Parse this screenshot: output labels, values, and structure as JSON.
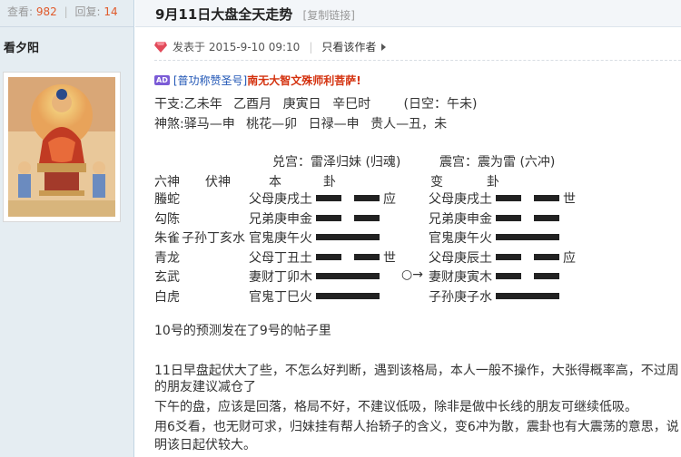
{
  "stats": {
    "views_label": "查看:",
    "views": "982",
    "replies_label": "回复:",
    "replies": "14"
  },
  "user": {
    "name": "看夕阳"
  },
  "thread": {
    "title": "9月11日大盘全天走势",
    "copy_link": "[复制链接]"
  },
  "post": {
    "posted_at": "发表于 2015-9-10 09:10",
    "only_author": "只看该作者"
  },
  "ad": {
    "badge": "AD",
    "link": "[普功称赞圣号]",
    "name": "南无大智文殊师利菩萨!"
  },
  "ganzhi": {
    "label": "干支:",
    "year": "乙未年",
    "month": "乙酉月",
    "day": "庚寅日",
    "hour": "辛巳时",
    "kong": "(日空：午未)"
  },
  "shensha": {
    "label": "神煞:",
    "items": [
      "驿马—申",
      "桃花—卯",
      "日禄—申",
      "贵人—丑，未"
    ]
  },
  "gua": {
    "ben_palace": "兑宫：雷泽归妹 (归魂)",
    "bian_palace": "震宫：震为雷 (六冲)",
    "headers": {
      "liushen": "六神",
      "fushen": "伏神",
      "ben": "本",
      "gua1": "卦",
      "bian": "变",
      "gua2": "卦"
    },
    "rows": [
      {
        "liushen": "螣蛇",
        "fushen": "",
        "ben": "父母庚戌土",
        "ben_yang": false,
        "mark": "应",
        "change": "",
        "bian": "父母庚戌土",
        "bian_yang": false,
        "bian_mark": "世"
      },
      {
        "liushen": "勾陈",
        "fushen": "",
        "ben": "兄弟庚申金",
        "ben_yang": false,
        "mark": "",
        "change": "",
        "bian": "兄弟庚申金",
        "bian_yang": false,
        "bian_mark": ""
      },
      {
        "liushen": "朱雀",
        "fushen": "子孙丁亥水",
        "ben": "官鬼庚午火",
        "ben_yang": true,
        "mark": "",
        "change": "",
        "bian": "官鬼庚午火",
        "bian_yang": true,
        "bian_mark": ""
      },
      {
        "liushen": "青龙",
        "fushen": "",
        "ben": "父母丁丑土",
        "ben_yang": false,
        "mark": "世",
        "change": "",
        "bian": "父母庚辰土",
        "bian_yang": false,
        "bian_mark": "应"
      },
      {
        "liushen": "玄武",
        "fushen": "",
        "ben": "妻财丁卯木",
        "ben_yang": true,
        "mark": "",
        "change": "○→",
        "bian": "妻财庚寅木",
        "bian_yang": false,
        "bian_mark": ""
      },
      {
        "liushen": "白虎",
        "fushen": "",
        "ben": "官鬼丁巳火",
        "ben_yang": true,
        "mark": "",
        "change": "",
        "bian": "子孙庚子水",
        "bian_yang": true,
        "bian_mark": ""
      }
    ]
  },
  "body": {
    "p1": "10号的预测发在了9号的帖子里",
    "p2a": "11日早盘起伏大了些，不怎么好判断，遇到该格局，本人一般不操作，大张得概率高，不过周",
    "p2b": "的朋友建议减仓了",
    "p3": "下午的盘，应该是回落，格局不好，不建议低吸，除非是做中长线的朋友可继续低吸。",
    "p4a": "用6爻看，也无财可求，归妹挂有帮人抬轿子的含义，变6冲为散，震卦也有大震荡的意思，说",
    "p4b": "明该日起伏较大。"
  }
}
